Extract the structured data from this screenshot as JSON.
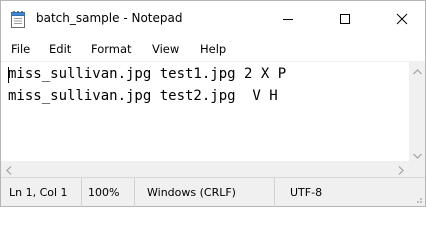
{
  "window": {
    "title": "batch_sample - Notepad",
    "icon": "notepad-icon"
  },
  "controls": {
    "minimize": "minimize-icon",
    "maximize": "maximize-icon",
    "close": "close-icon"
  },
  "menu": {
    "items": [
      "File",
      "Edit",
      "Format",
      "View",
      "Help"
    ]
  },
  "editor": {
    "lines": [
      "miss_sullivan.jpg test1.jpg 2 X P",
      "miss_sullivan.jpg test2.jpg  V H"
    ]
  },
  "statusbar": {
    "position": "Ln 1, Col 1",
    "zoom": "100%",
    "line_ending": "Windows (CRLF)",
    "encoding": "UTF-8"
  },
  "colors": {
    "chrome": "#f0f0f0",
    "text": "#000000",
    "arrow": "#a0a0a0"
  }
}
